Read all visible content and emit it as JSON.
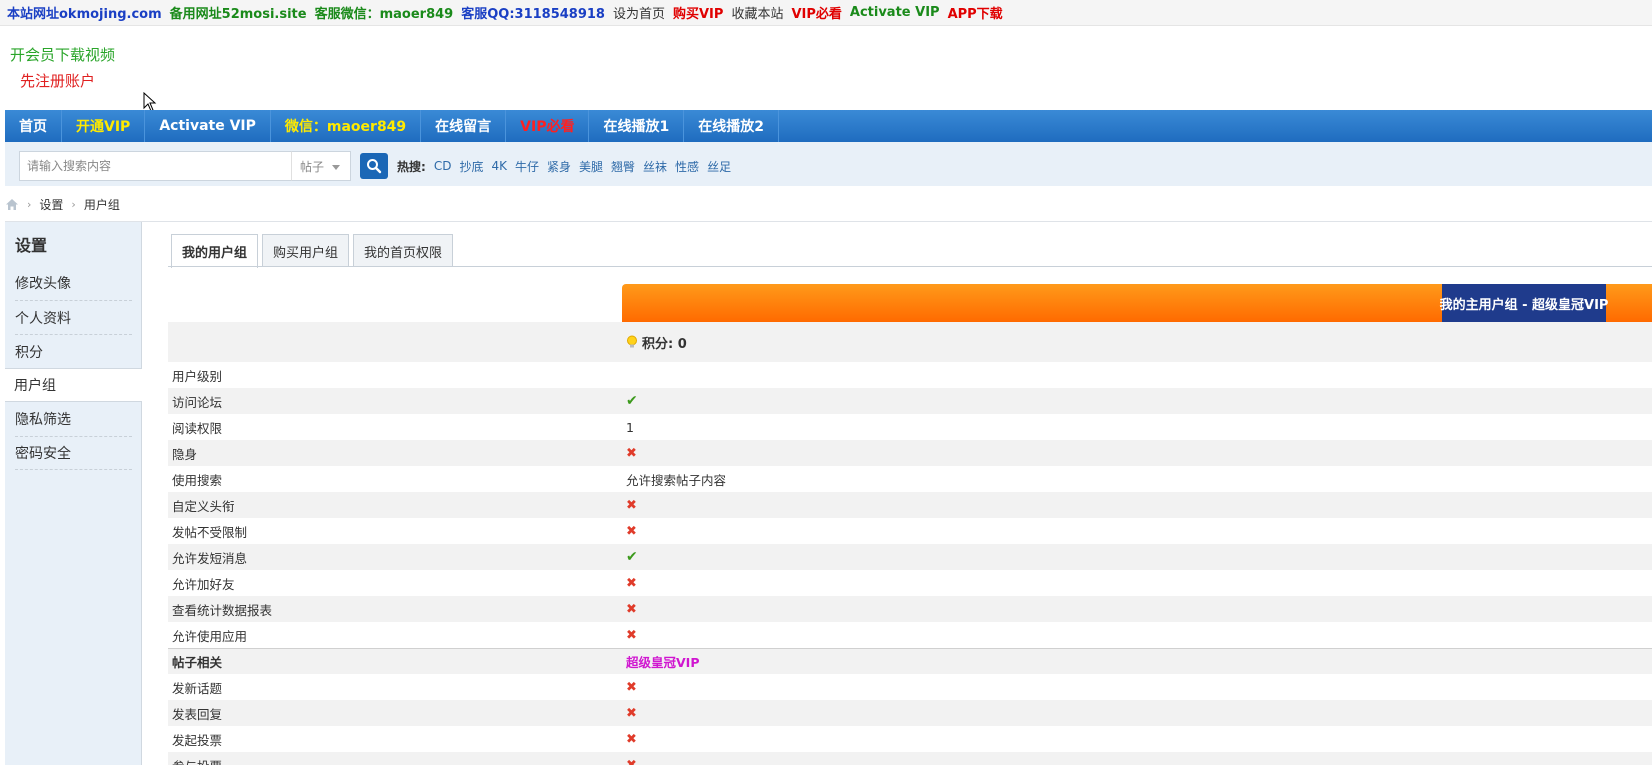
{
  "topbar": {
    "site_url": "本站网址okmojing.com",
    "backup_url": "备用网址52mosi.site",
    "wechat": "客服微信：maoer849",
    "qq": "客服QQ:3118548918",
    "set_home": "设为首页",
    "buy_vip": "购买VIP",
    "bookmark": "收藏本站",
    "vip_must": "VIP必看",
    "activate_vip": "Activate VIP",
    "app_download": "APP下载",
    "colors": {
      "blue": "#1a3fc4",
      "green": "#1a8a1a",
      "red": "#e00000"
    }
  },
  "promo": {
    "line1": "开会员下载视频",
    "line2": "先注册账户"
  },
  "nav": {
    "items": [
      {
        "label": "首页",
        "color": "#ffffff"
      },
      {
        "label": "开通VIP",
        "color": "#ffea00"
      },
      {
        "label": "Activate VIP",
        "color": "#ffffff"
      },
      {
        "label": "微信：maoer849",
        "color": "#ffea00"
      },
      {
        "label": "在线留言",
        "color": "#ffffff"
      },
      {
        "label": "VIP必看",
        "color": "#ff2020"
      },
      {
        "label": "在线播放1",
        "color": "#ffffff"
      },
      {
        "label": "在线播放2",
        "color": "#ffffff"
      }
    ]
  },
  "search": {
    "placeholder": "请输入搜索内容",
    "scope": "帖子",
    "hot_label": "热搜:",
    "hot_keywords": [
      "CD",
      "抄底",
      "4K",
      "牛仔",
      "紧身",
      "美腿",
      "翘臀",
      "丝袜",
      "性感",
      "丝足"
    ]
  },
  "breadcrumb": {
    "items": [
      "设置",
      "用户组"
    ]
  },
  "sidebar": {
    "title": "设置",
    "items": [
      "修改头像",
      "个人资料",
      "积分",
      "用户组",
      "隐私筛选",
      "密码安全"
    ],
    "active_index": 3
  },
  "tabs": {
    "items": [
      "我的用户组",
      "购买用户组",
      "我的首页权限"
    ],
    "active_index": 0
  },
  "group": {
    "label": "我的主用户组 - 超级皇冠VIP",
    "points": "积分: 0"
  },
  "permissions": {
    "rows": [
      {
        "name": "用户级别",
        "kind": "text",
        "value": ""
      },
      {
        "name": "访问论坛",
        "kind": "check",
        "value": "yes"
      },
      {
        "name": "阅读权限",
        "kind": "text",
        "value": "1"
      },
      {
        "name": "隐身",
        "kind": "check",
        "value": "no"
      },
      {
        "name": "使用搜索",
        "kind": "text",
        "value": "允许搜索帖子内容"
      },
      {
        "name": "自定义头衔",
        "kind": "check",
        "value": "no"
      },
      {
        "name": "发帖不受限制",
        "kind": "check",
        "value": "no"
      },
      {
        "name": "允许发短消息",
        "kind": "check",
        "value": "yes"
      },
      {
        "name": "允许加好友",
        "kind": "check",
        "value": "no"
      },
      {
        "name": "查看统计数据报表",
        "kind": "check",
        "value": "no"
      },
      {
        "name": "允许使用应用",
        "kind": "check",
        "value": "no"
      },
      {
        "name": "帖子相关",
        "kind": "section",
        "value": "超级皇冠VIP"
      },
      {
        "name": "发新话题",
        "kind": "check",
        "value": "no"
      },
      {
        "name": "发表回复",
        "kind": "check",
        "value": "no"
      },
      {
        "name": "发起投票",
        "kind": "check",
        "value": "no"
      },
      {
        "name": "参与投票",
        "kind": "check",
        "value": "no"
      }
    ]
  }
}
